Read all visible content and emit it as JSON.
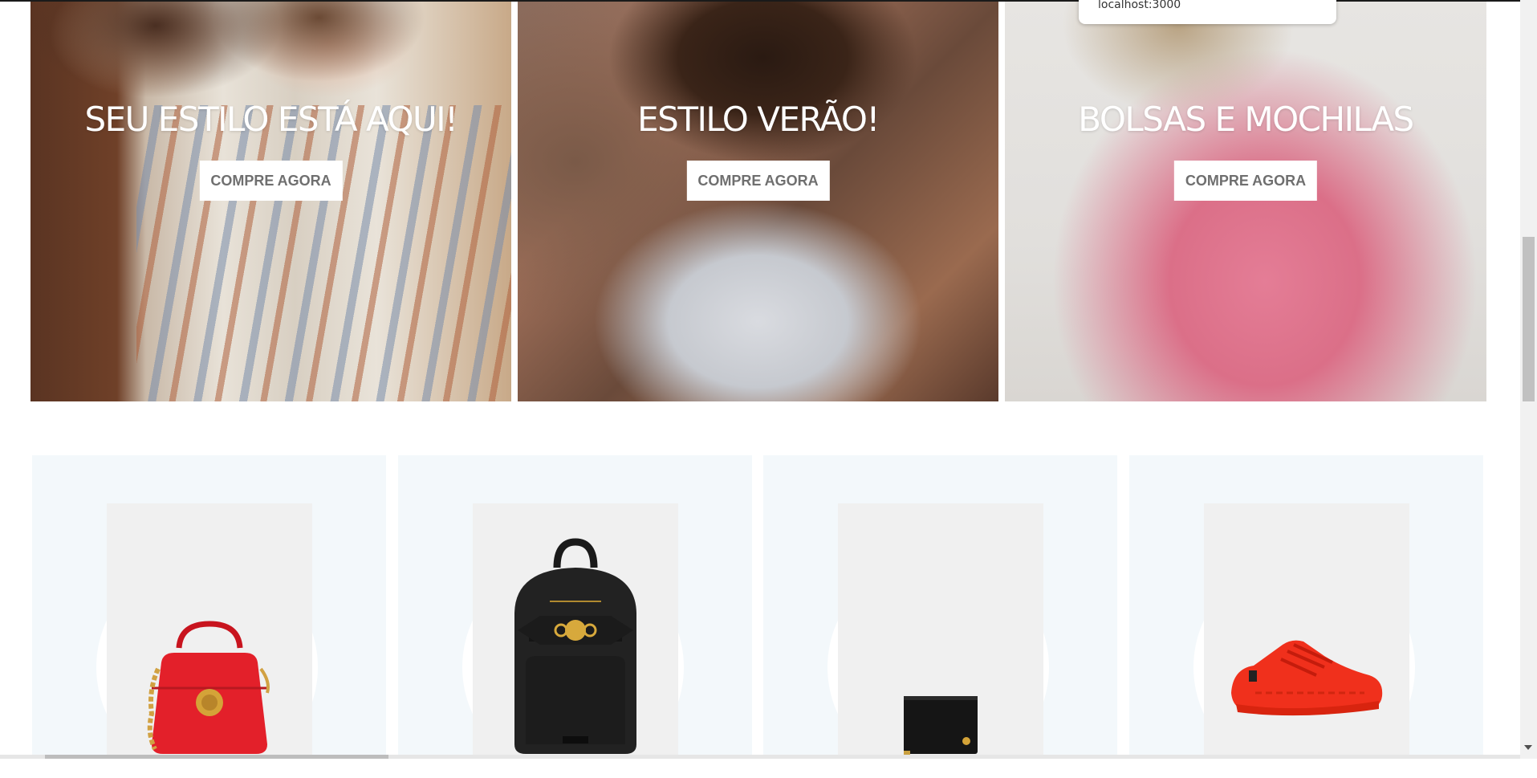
{
  "browser": {
    "status_url": "localhost:3000"
  },
  "banners": [
    {
      "title": "SEU ESTILO ESTÁ AQUI!",
      "cta": "COMPRE AGORA"
    },
    {
      "title": "ESTILO VERÃO!",
      "cta": "COMPRE AGORA"
    },
    {
      "title": "BOLSAS E MOCHILAS",
      "cta": "COMPRE AGORA"
    }
  ],
  "products": [
    {
      "image": "red-handbag",
      "color": "#e3202a"
    },
    {
      "image": "black-backpack",
      "color": "#1c1c1c"
    },
    {
      "image": "black-wallet",
      "color": "#111111"
    },
    {
      "image": "red-sneaker",
      "color": "#f0301c"
    }
  ]
}
